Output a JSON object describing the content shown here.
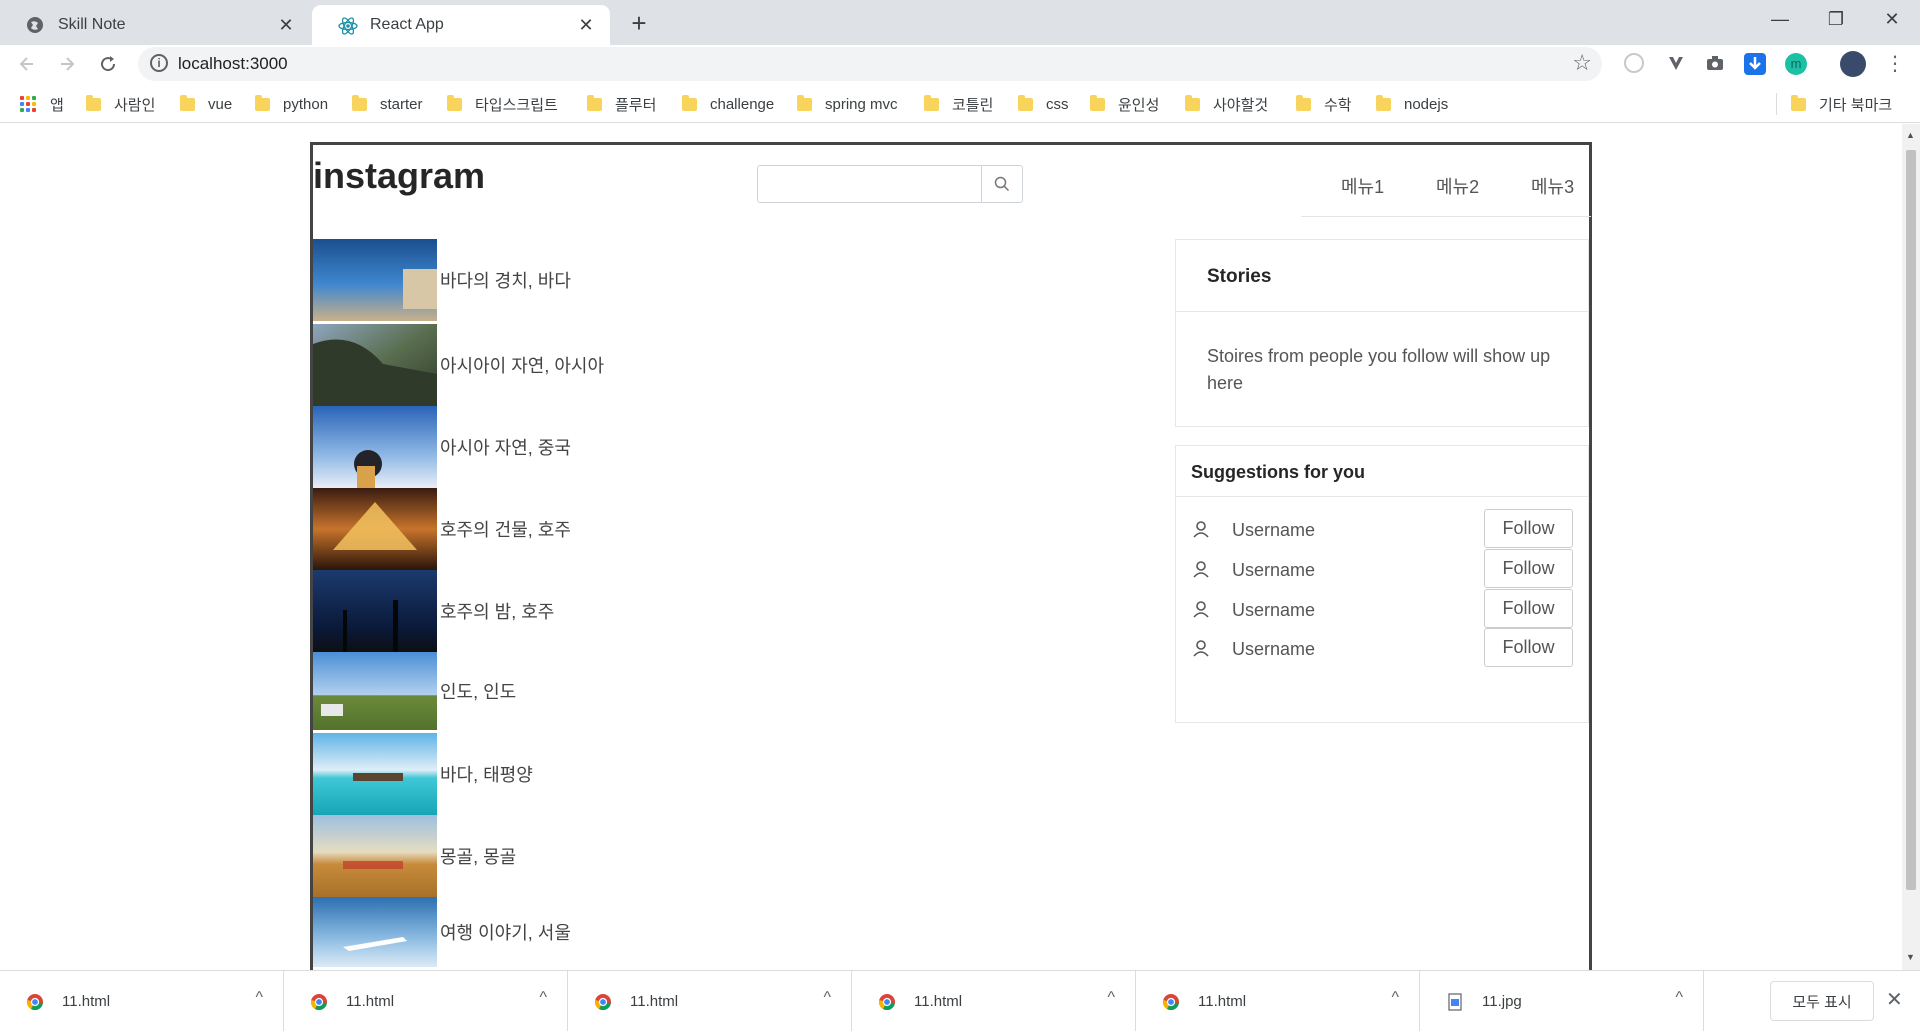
{
  "tabs": [
    {
      "label": "Skill Note",
      "close": "✕"
    },
    {
      "label": "React App",
      "close": "✕"
    }
  ],
  "new_tab": "+",
  "window_controls": {
    "minimize": "—",
    "maximize": "❐",
    "close": "✕"
  },
  "omnibox": {
    "info": "i",
    "url": "localhost:3000",
    "star": "☆"
  },
  "bookmarks": {
    "apps": "앱",
    "items": [
      "사람인",
      "vue",
      "python",
      "starter",
      "타입스크립트",
      "플루터",
      "challenge",
      "spring mvc",
      "코틀린",
      "css",
      "윤인성",
      "사야할것",
      "수학",
      "nodejs"
    ],
    "other": "기타 북마크"
  },
  "page": {
    "logo": "instagram",
    "search": {
      "value": "",
      "placeholder": ""
    },
    "menu": [
      "메뉴1",
      "메뉴2",
      "메뉴3"
    ],
    "feed": [
      {
        "label": "바다의 경치, 바다",
        "colors": [
          "#1a4f8f",
          "#3f87cf",
          "#c9b08a"
        ]
      },
      {
        "label": "아시아이 자연, 아시아",
        "colors": [
          "#2f3a2a",
          "#5a6e4f",
          "#8ea6bf"
        ]
      },
      {
        "label": "아시아 자연, 중국",
        "colors": [
          "#2a64b8",
          "#8fb8e6",
          "#e8eef6"
        ]
      },
      {
        "label": "호주의 건물, 호주",
        "colors": [
          "#3a1c10",
          "#c7742c",
          "#f2c25f"
        ]
      },
      {
        "label": "호주의 밤, 호주",
        "colors": [
          "#0a1a3a",
          "#1c3a6e",
          "#0d0f14"
        ]
      },
      {
        "label": "인도, 인도",
        "colors": [
          "#4a8fd6",
          "#b3d0ee",
          "#6a8a3a"
        ]
      },
      {
        "label": "바다, 태평양",
        "colors": [
          "#5fb3e8",
          "#3fc7d6",
          "#17a5b5"
        ]
      },
      {
        "label": "몽골, 몽골",
        "colors": [
          "#9cc0de",
          "#e6dcc1",
          "#c78b3a"
        ]
      },
      {
        "label": "여행 이야기, 서울",
        "colors": [
          "#2d6fb0",
          "#8ebde3",
          "#dcebf5"
        ]
      }
    ],
    "stories": {
      "title": "Stories",
      "body": "Stoires from people you follow will show up here"
    },
    "suggestions": {
      "title": "Suggestions for you",
      "users": [
        {
          "name": "Username",
          "button": "Follow"
        },
        {
          "name": "Username",
          "button": "Follow"
        },
        {
          "name": "Username",
          "button": "Follow"
        },
        {
          "name": "Username",
          "button": "Follow"
        }
      ]
    }
  },
  "downloads": {
    "items": [
      "11.html",
      "11.html",
      "11.html",
      "11.html",
      "11.html",
      "11.jpg"
    ],
    "chevron": "^",
    "show_all": "모두 표시",
    "close": "✕"
  },
  "colors": {
    "accent": "#1a73e8",
    "folder": "#f9d45c",
    "tab_bar": "#dee1e6",
    "border": "#444444"
  }
}
